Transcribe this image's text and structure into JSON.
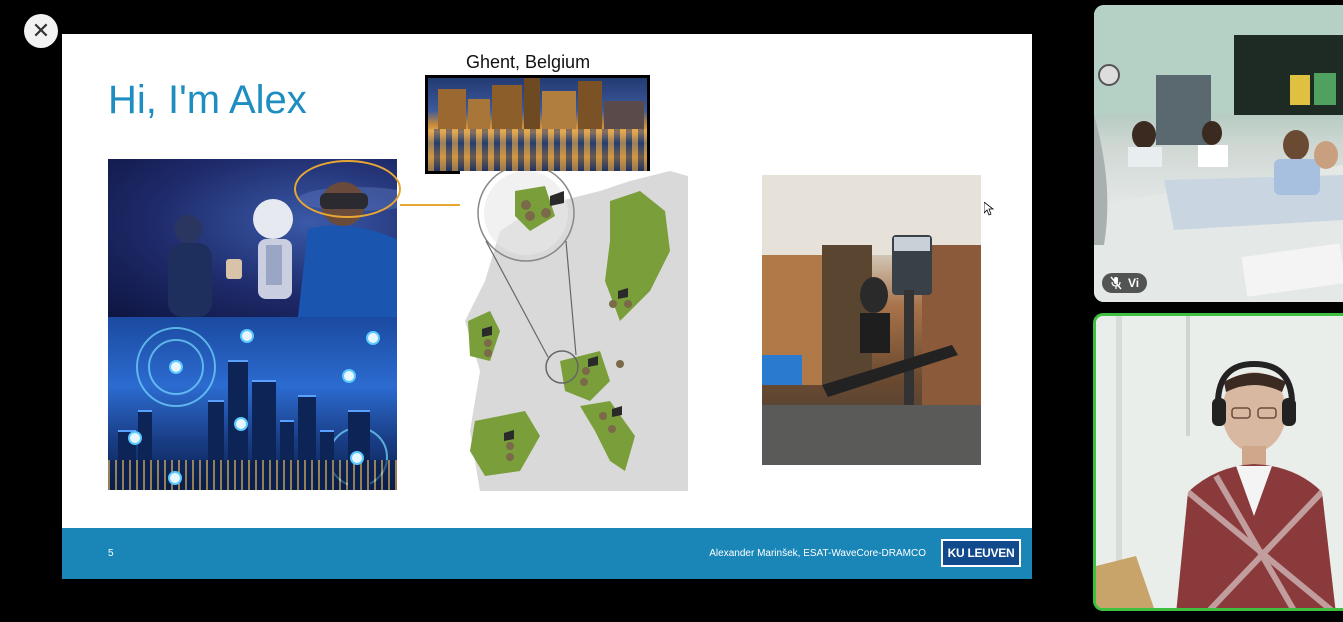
{
  "viewer": {
    "close_icon": "close-icon",
    "close_glyph": "✕"
  },
  "slide": {
    "title": "Hi, I'm Alex",
    "location_label": "Ghent, Belgium",
    "page_number": "5",
    "author": "Alexander Marinšek, ESAT-WaveCore-DRAMCO",
    "logo_text": "KU LEUVEN",
    "colors": {
      "title": "#1d8dc2",
      "footer": "#1a86b8",
      "highlight": "#e8a633",
      "map_country": "#7a9e3a",
      "map_land": "#d9d9d9"
    }
  },
  "participants": [
    {
      "name": "Vi",
      "muted": true,
      "speaking": false
    },
    {
      "name": "",
      "muted": false,
      "speaking": true
    }
  ],
  "colors": {
    "speaking_border": "#3fbf3f"
  }
}
